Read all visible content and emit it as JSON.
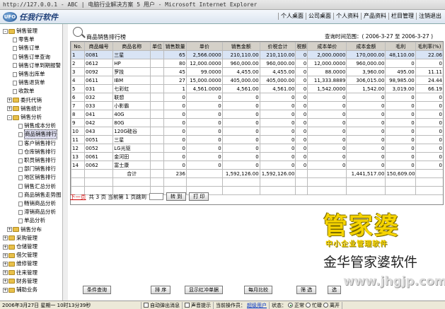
{
  "window": {
    "title": "http://127.0.0.1 - ABC | 电脑行业解决方案 5 用户 - Microsoft Internet Explorer"
  },
  "header": {
    "logo_text": "任我行软件",
    "logo_mark": "UFO",
    "nav": [
      "个人桌面",
      "公司桌面",
      "个人资料",
      "产品资料",
      "栏目管理",
      "注销退出"
    ]
  },
  "sidebar": {
    "items": [
      {
        "label": "销售管理",
        "level": 0,
        "kind": "folder",
        "expanded": true
      },
      {
        "label": "零售单",
        "level": 2,
        "kind": "doc"
      },
      {
        "label": "销售订单",
        "level": 2,
        "kind": "doc"
      },
      {
        "label": "销售订单查询",
        "level": 2,
        "kind": "doc"
      },
      {
        "label": "销售订单到期报警",
        "level": 2,
        "kind": "doc"
      },
      {
        "label": "销售出库单",
        "level": 2,
        "kind": "doc"
      },
      {
        "label": "销售退货单",
        "level": 2,
        "kind": "doc"
      },
      {
        "label": "收款单",
        "level": 2,
        "kind": "doc"
      },
      {
        "label": "委托代销",
        "level": 1,
        "kind": "folder",
        "expanded": false
      },
      {
        "label": "销售统计",
        "level": 1,
        "kind": "folder",
        "expanded": false
      },
      {
        "label": "销售分析",
        "level": 1,
        "kind": "folder",
        "expanded": true
      },
      {
        "label": "销售成本分析",
        "level": 3,
        "kind": "doc"
      },
      {
        "label": "商品销售排行",
        "level": 3,
        "kind": "doc",
        "selected": true
      },
      {
        "label": "客户销售排行",
        "level": 3,
        "kind": "doc"
      },
      {
        "label": "仓库销售排行",
        "level": 3,
        "kind": "doc"
      },
      {
        "label": "职员销售排行",
        "level": 3,
        "kind": "doc"
      },
      {
        "label": "部门销售排行",
        "level": 3,
        "kind": "doc"
      },
      {
        "label": "地区销售排行",
        "level": 3,
        "kind": "doc"
      },
      {
        "label": "销售汇总分析",
        "level": 3,
        "kind": "doc"
      },
      {
        "label": "商品销售走势图",
        "level": 3,
        "kind": "doc"
      },
      {
        "label": "畅销商品分析",
        "level": 3,
        "kind": "doc"
      },
      {
        "label": "滞销商品分析",
        "level": 3,
        "kind": "doc"
      },
      {
        "label": "单品分析",
        "level": 3,
        "kind": "doc"
      },
      {
        "label": "销售分布",
        "level": 1,
        "kind": "folder",
        "expanded": false
      },
      {
        "label": "采购管理",
        "level": 0,
        "kind": "folder",
        "expanded": false
      },
      {
        "label": "仓储管理",
        "level": 0,
        "kind": "folder",
        "expanded": false
      },
      {
        "label": "借欠管理",
        "level": 0,
        "kind": "folder",
        "expanded": false
      },
      {
        "label": "维修管理",
        "level": 0,
        "kind": "folder",
        "expanded": false
      },
      {
        "label": "往来管理",
        "level": 0,
        "kind": "folder",
        "expanded": false
      },
      {
        "label": "财务管理",
        "level": 0,
        "kind": "folder",
        "expanded": false
      },
      {
        "label": "辅助业务",
        "level": 0,
        "kind": "folder",
        "expanded": false
      }
    ]
  },
  "report": {
    "title": "商品销售排行榜",
    "query_range": "查询时间范围：( 2006-3-27 至 2006-3-27 )",
    "columns": [
      "No.",
      "商品编号",
      "商品名称",
      "单位",
      "销售数量",
      "单价",
      "销售金额",
      "价税合计",
      "税额",
      "成本单价",
      "成本金额",
      "毛利",
      "毛利率(%)"
    ],
    "rows": [
      [
        "1",
        "0081",
        "三星",
        "",
        "65",
        "2,566.0000",
        "210,110.00",
        "210,110.00",
        "0",
        "2,000.0000",
        "170,000.00",
        "48,110.00",
        "22.06"
      ],
      [
        "2",
        "0612",
        "HP",
        "",
        "80",
        "12,000.0000",
        "960,000.00",
        "960,000.00",
        "0",
        "12,000.0000",
        "960,000.00",
        "0",
        "0"
      ],
      [
        "3",
        "0092",
        "罗技",
        "",
        "45",
        "99.0000",
        "4,455.00",
        "4,455.00",
        "0",
        "88.0000",
        "3,960.00",
        "495.00",
        "11.11"
      ],
      [
        "4",
        "0611",
        "IBM",
        "",
        "27",
        "15,000.0000",
        "405,000.00",
        "405,000.00",
        "0",
        "11,333.8889",
        "306,015.00",
        "98,985.00",
        "24.44"
      ],
      [
        "5",
        "031",
        "七彩虹",
        "",
        "1",
        "4,561.0000",
        "4,561.00",
        "4,561.00",
        "0",
        "1,542.0000",
        "1,542.00",
        "3,019.00",
        "66.19"
      ],
      [
        "6",
        "032",
        "联想",
        "",
        "0",
        "0",
        "0",
        "0",
        "0",
        "0",
        "0",
        "0",
        "0"
      ],
      [
        "7",
        "033",
        "小影霸",
        "",
        "0",
        "0",
        "0",
        "0",
        "0",
        "0",
        "0",
        "0",
        "0"
      ],
      [
        "8",
        "041",
        "40G",
        "",
        "0",
        "0",
        "0",
        "0",
        "0",
        "0",
        "0",
        "0",
        "0"
      ],
      [
        "9",
        "042",
        "80G",
        "",
        "0",
        "0",
        "0",
        "0",
        "0",
        "0",
        "0",
        "0",
        "0"
      ],
      [
        "10",
        "043",
        "120G硅谷",
        "",
        "0",
        "0",
        "0",
        "0",
        "0",
        "0",
        "0",
        "0",
        "0"
      ],
      [
        "11",
        "0051",
        "三星",
        "",
        "0",
        "0",
        "0",
        "0",
        "0",
        "0",
        "0",
        "0",
        "0"
      ],
      [
        "12",
        "0052",
        "LG光驱",
        "",
        "0",
        "0",
        "0",
        "0",
        "0",
        "0",
        "0",
        "0",
        "0"
      ],
      [
        "13",
        "0061",
        "金河田",
        "",
        "0",
        "0",
        "0",
        "0",
        "0",
        "0",
        "0",
        "0",
        "0"
      ],
      [
        "14",
        "0062",
        "富士康",
        "",
        "0",
        "0",
        "0",
        "0",
        "0",
        "0",
        "0",
        "0",
        "0"
      ]
    ],
    "total": {
      "label": "合计",
      "qty": "236",
      "amount": "1,592,126.00",
      "tax_total": "1,592,126.00",
      "cost": "1,441,517.00",
      "profit": "150,609.00"
    }
  },
  "pager": {
    "next": "下一页",
    "info": "共 3 页 当前第 1 页跳到",
    "page_value": "",
    "goto": "转 到",
    "print": "打 印"
  },
  "watermark": {
    "big": "管家婆",
    "small": "中小企业管理软件",
    "name": "金华管家婆软件",
    "url": "www.jhgjp.com"
  },
  "buttons": {
    "condition": "条件查询",
    "sort": "排 序",
    "show_red": "显示红冲单据",
    "monthly": "每月比较",
    "filter": "筛 选",
    "other": "选"
  },
  "status": {
    "date": "2006年3月27日 星期一 10时13分39秒",
    "auto_popup": "自动弹出消息",
    "sound": "声音提示",
    "operator_label": "当前操作员：",
    "operator": "超级用户",
    "state_label": "状态：",
    "state_normal": "正常",
    "state_busy": "忙碌",
    "state_away": "离开"
  },
  "colors": {
    "highlight_row": "#d9e4f5",
    "watermark": "#f6d400"
  }
}
